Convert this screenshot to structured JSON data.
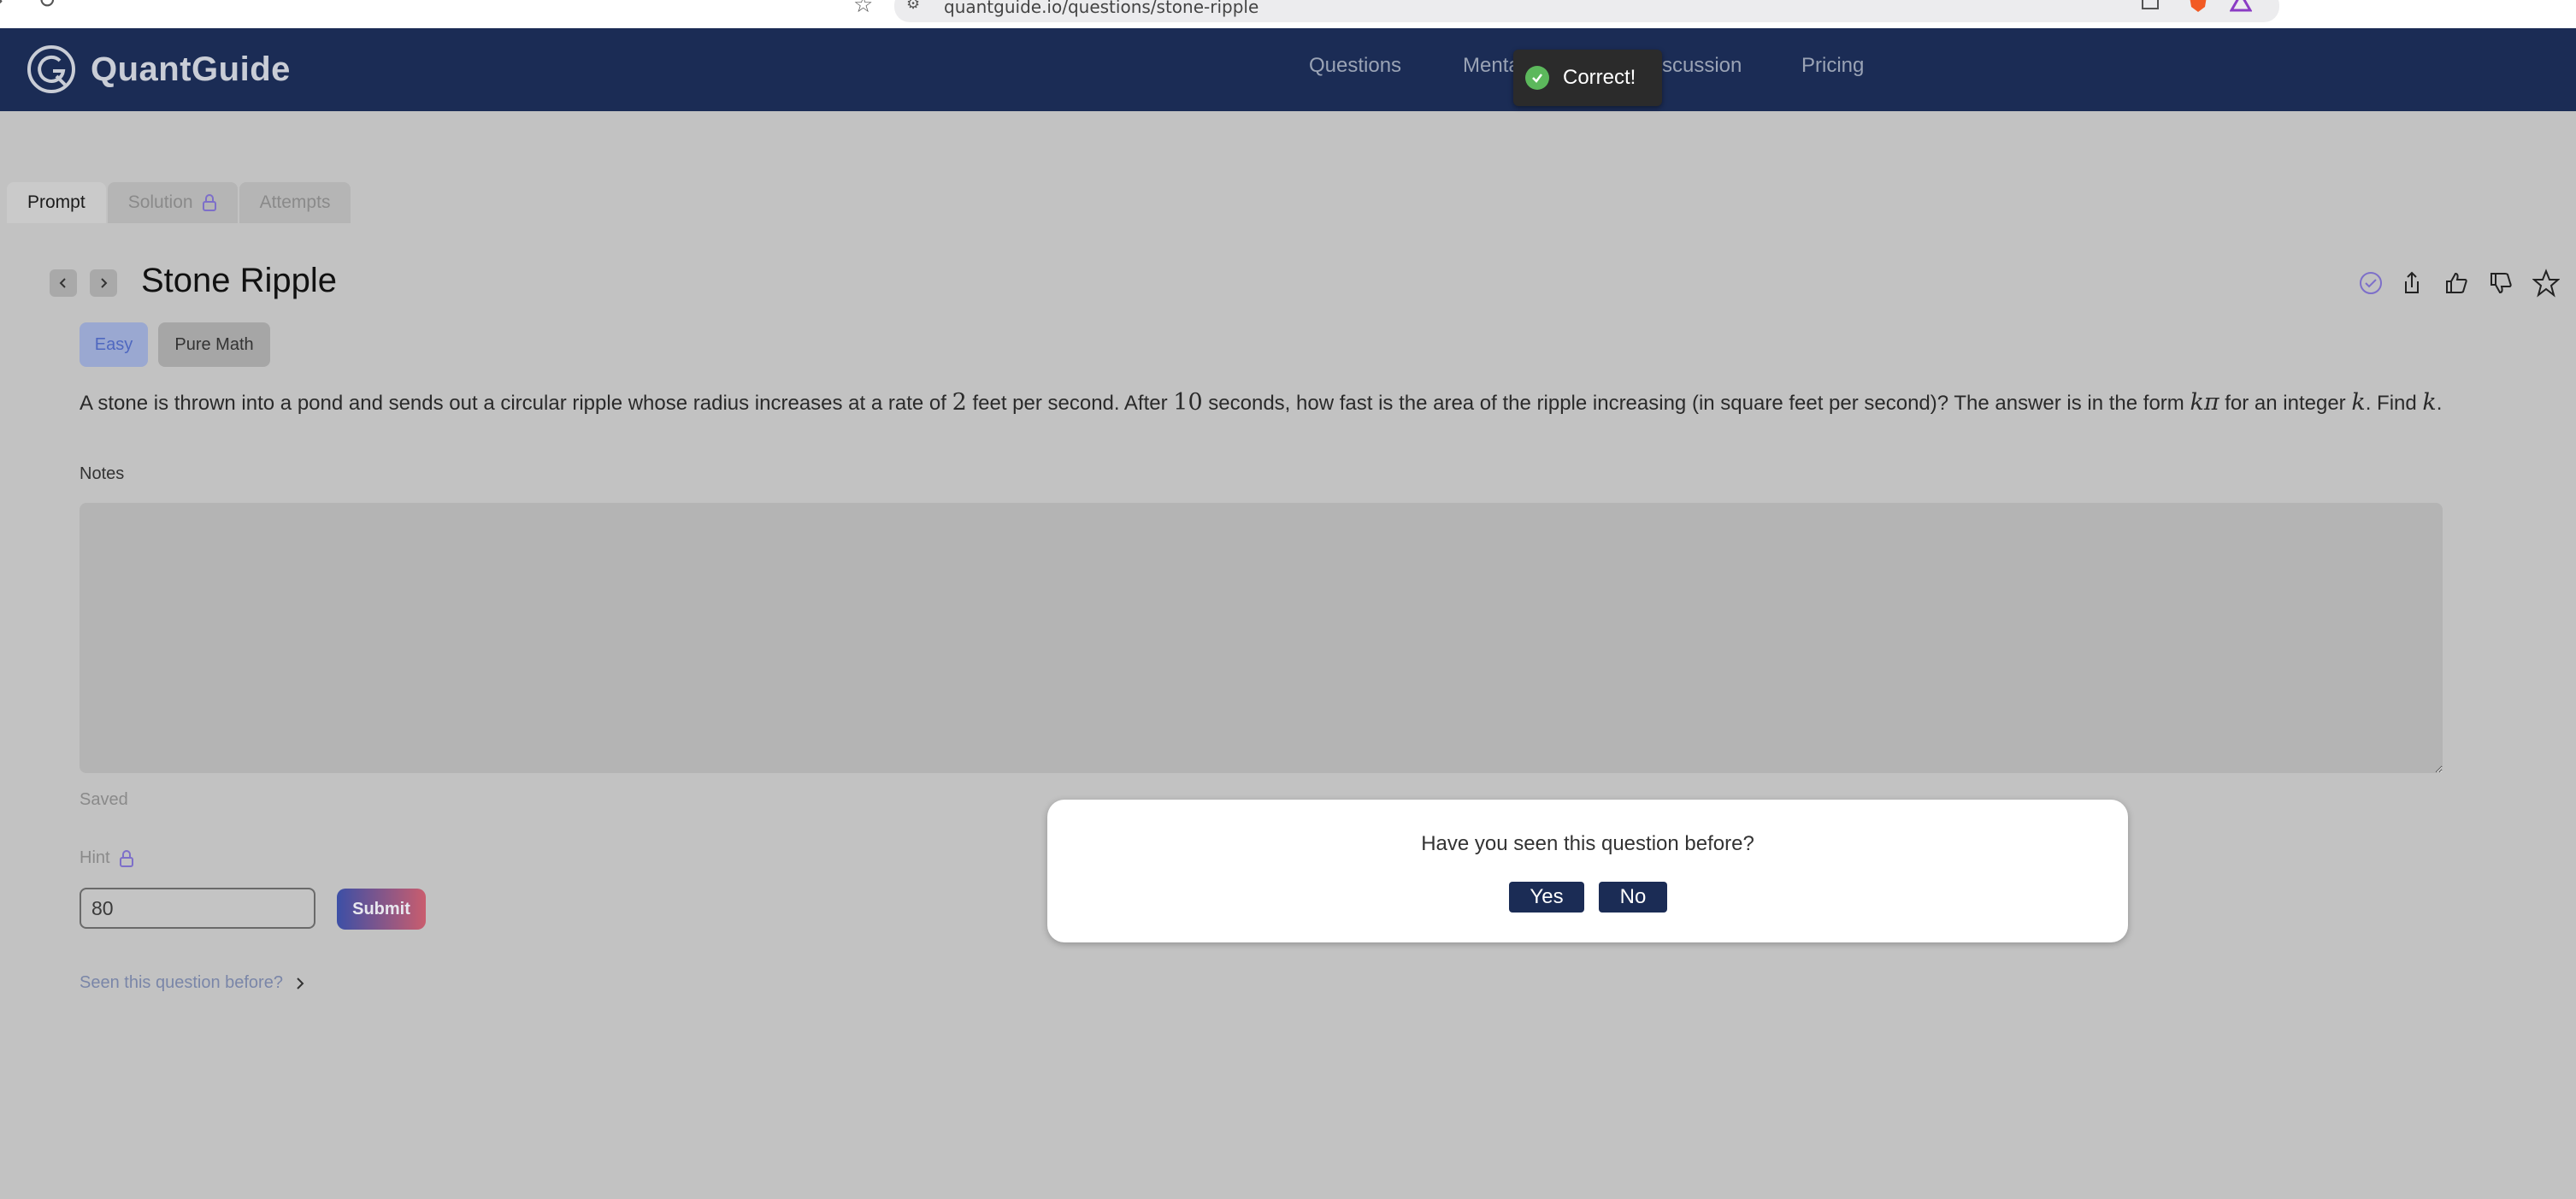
{
  "browser": {
    "url": "quantguide.io/questions/stone-ripple"
  },
  "header": {
    "brand": "QuantGuide",
    "nav": [
      {
        "label": "Questions"
      },
      {
        "label": "Menta"
      },
      {
        "label": "scussion"
      },
      {
        "label": "Pricing"
      }
    ]
  },
  "toast": {
    "message": "Correct!"
  },
  "tabs": [
    {
      "label": "Prompt",
      "active": true
    },
    {
      "label": "Solution",
      "locked": true
    },
    {
      "label": "Attempts"
    }
  ],
  "question": {
    "title": "Stone Ripple",
    "difficulty": "Easy",
    "topic": "Pure Math",
    "prompt": {
      "p1": "A stone is thrown into a pond and sends out a circular ripple whose radius increases at a rate of ",
      "n1": "2",
      "p2": " feet per second. After ",
      "n2": "10",
      "p3": " seconds, how fast is the area of the ripple increasing (in square feet per second)? The answer is in the form ",
      "m1": "kπ",
      "p4": " for an integer ",
      "m2": "k",
      "p5": ". Find ",
      "m3": "k",
      "p6": "."
    }
  },
  "notes": {
    "label": "Notes",
    "status": "Saved"
  },
  "hint": {
    "label": "Hint"
  },
  "answer": {
    "value": "80",
    "submit_label": "Submit"
  },
  "seen_link": "Seen this question before?",
  "modal": {
    "question": "Have you seen this question before?",
    "yes_label": "Yes",
    "no_label": "No"
  },
  "icons": {
    "check": "check-circle-icon",
    "share": "share-icon",
    "like": "thumbs-up-icon",
    "dislike": "thumbs-down-icon",
    "favorite": "star-icon",
    "lock": "lock-icon"
  },
  "colors": {
    "header_bg": "#1b2c55",
    "accent": "#4f68c0",
    "toast_bg": "#2b2b2b",
    "toast_check": "#5cb85c"
  }
}
